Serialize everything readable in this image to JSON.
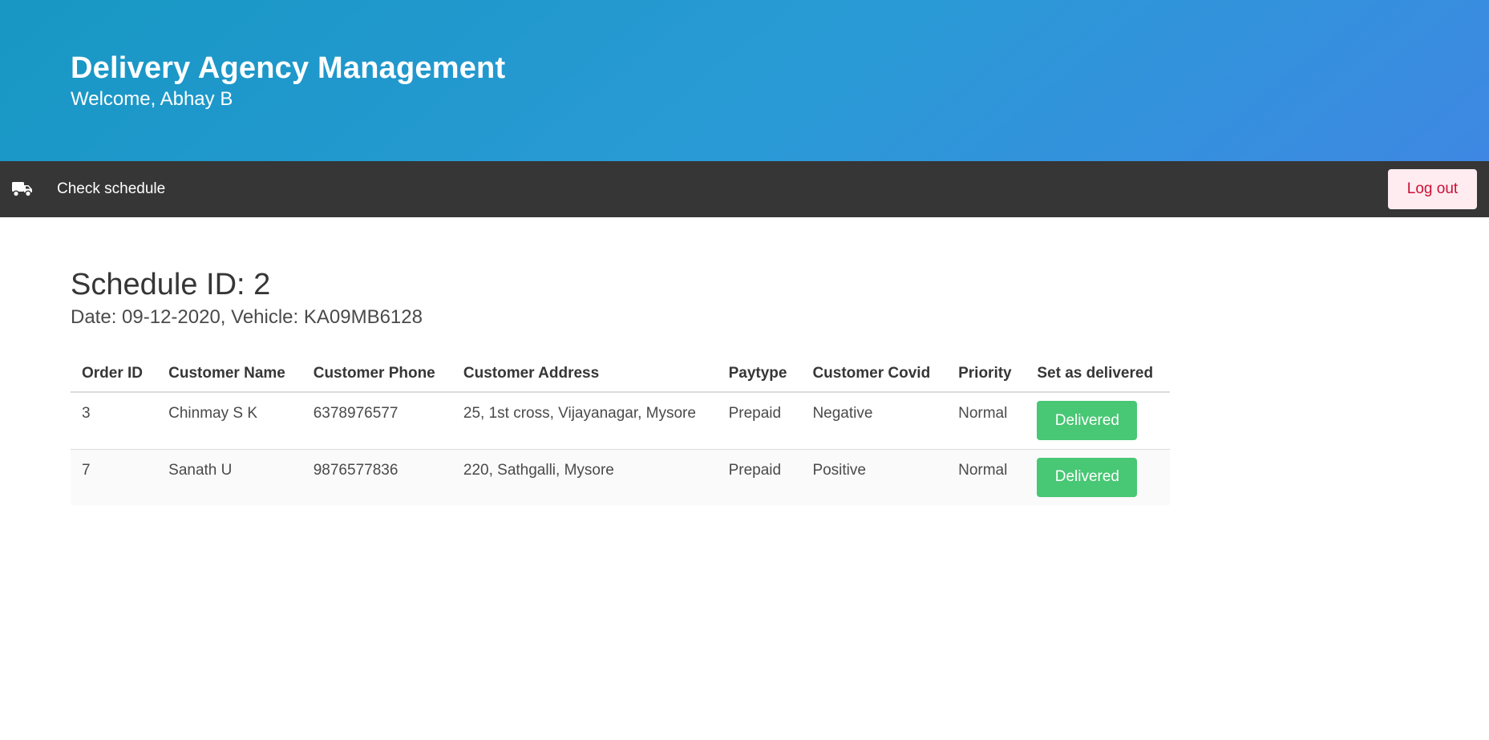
{
  "header": {
    "title": "Delivery Agency Management",
    "welcome": "Welcome, Abhay B"
  },
  "navbar": {
    "icon": "truck-icon",
    "link_label": "Check schedule",
    "logout_label": "Log out"
  },
  "schedule": {
    "title": "Schedule ID: 2",
    "subtitle": "Date: 09-12-2020, Vehicle: KA09MB6128"
  },
  "table": {
    "columns": [
      "Order ID",
      "Customer Name",
      "Customer Phone",
      "Customer Address",
      "Paytype",
      "Customer Covid",
      "Priority",
      "Set as delivered"
    ],
    "rows": [
      {
        "order_id": "3",
        "name": "Chinmay S K",
        "phone": "6378976577",
        "address": "25, 1st cross, Vijayanagar, Mysore",
        "paytype": "Prepaid",
        "covid": "Negative",
        "priority": "Normal",
        "action": "Delivered"
      },
      {
        "order_id": "7",
        "name": "Sanath U",
        "phone": "9876577836",
        "address": "220, Sathgalli, Mysore",
        "paytype": "Prepaid",
        "covid": "Positive",
        "priority": "Normal",
        "action": "Delivered"
      }
    ]
  },
  "colors": {
    "hero_gradient_start": "#1797c3",
    "hero_gradient_end": "#3e88e3",
    "navbar_bg": "#363636",
    "logout_bg": "#feecf0",
    "logout_text": "#cc0f35",
    "delivered_button": "#48c774"
  }
}
